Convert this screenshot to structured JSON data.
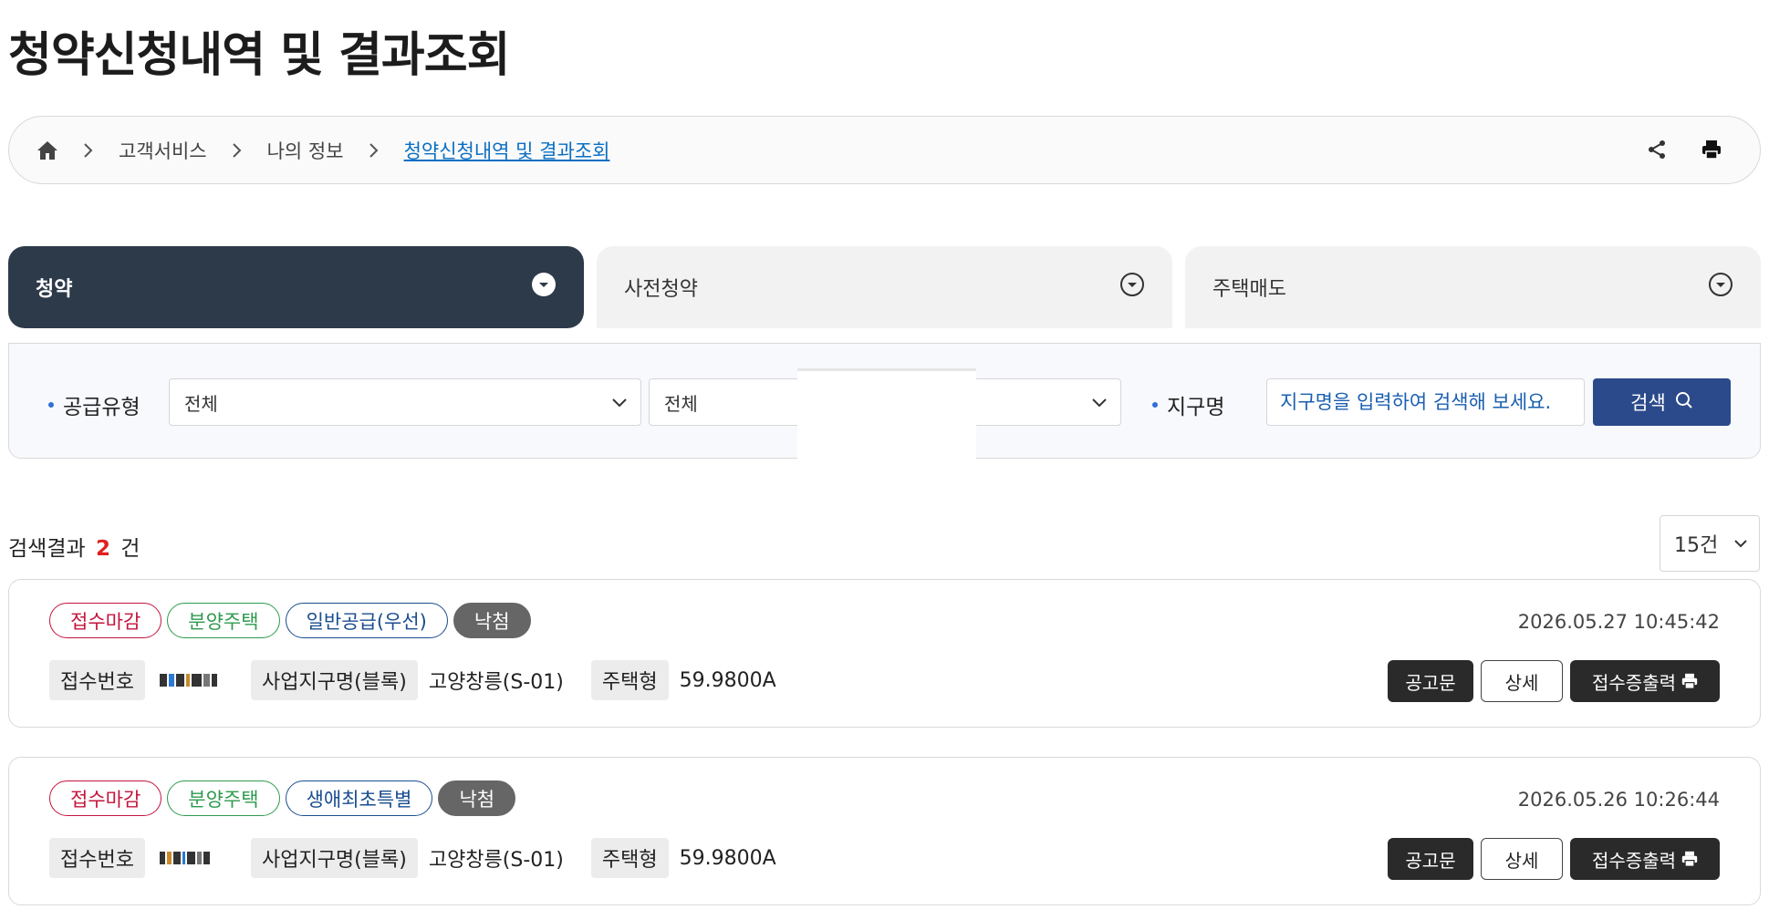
{
  "page_title": "청약신청내역 및 결과조회",
  "breadcrumb": {
    "items": [
      "고객서비스",
      "나의 정보"
    ],
    "current": "청약신청내역 및 결과조회"
  },
  "tabs": [
    {
      "label": "청약",
      "active": true
    },
    {
      "label": "사전청약",
      "active": false
    },
    {
      "label": "주택매도",
      "active": false
    }
  ],
  "filter": {
    "supply_type_label": "공급유형",
    "select1_value": "전체",
    "select2_value": "전체",
    "district_label": "지구명",
    "district_placeholder": "지구명을 입력하여 검색해 보세요.",
    "search_button": "검색"
  },
  "results": {
    "prefix": "검색결과",
    "count": "2",
    "suffix": "건",
    "page_size": "15건"
  },
  "cards": [
    {
      "badges": [
        {
          "text": "접수마감",
          "color": "red"
        },
        {
          "text": "분양주택",
          "color": "green"
        },
        {
          "text": "일반공급(우선)",
          "color": "blue"
        },
        {
          "text": "낙첨",
          "color": "dark"
        }
      ],
      "date": "2026.05.27 10:45:42",
      "receipt_label": "접수번호",
      "district_label": "사업지구명(블록)",
      "district_value": "고양창릉(S-01)",
      "house_type_label": "주택형",
      "house_type_value": "59.9800A",
      "btn_notice": "공고문",
      "btn_detail": "상세",
      "btn_print": "접수증출력"
    },
    {
      "badges": [
        {
          "text": "접수마감",
          "color": "red"
        },
        {
          "text": "분양주택",
          "color": "green"
        },
        {
          "text": "생애최초특별",
          "color": "blue"
        },
        {
          "text": "낙첨",
          "color": "dark"
        }
      ],
      "date": "2026.05.26 10:26:44",
      "receipt_label": "접수번호",
      "district_label": "사업지구명(블록)",
      "district_value": "고양창릉(S-01)",
      "house_type_label": "주택형",
      "house_type_value": "59.9800A",
      "btn_notice": "공고문",
      "btn_detail": "상세",
      "btn_print": "접수증출력"
    }
  ],
  "colors": {
    "active_tab": "#2d3a4a",
    "search_button": "#2b4a8b",
    "link": "#0a6fc2",
    "count": "#e02020"
  }
}
